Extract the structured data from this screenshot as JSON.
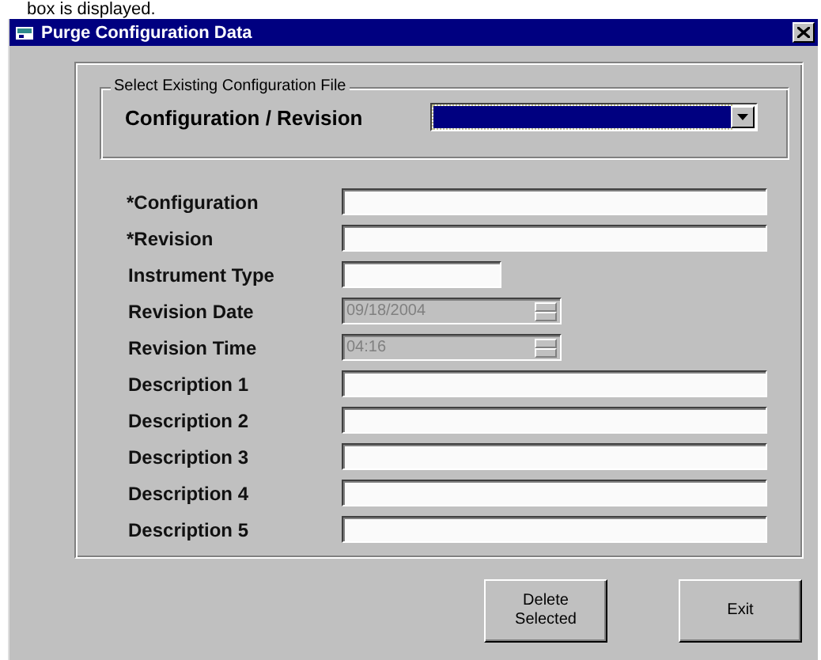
{
  "caption": "box is displayed.",
  "window": {
    "title": "Purge Configuration Data"
  },
  "group": {
    "title": "Select Existing Configuration File",
    "label": "Configuration / Revision",
    "dropdown": {
      "focused": true
    }
  },
  "fields": [
    {
      "label": "*Configuration",
      "kind": "wide",
      "disabled": false
    },
    {
      "label": "*Revision",
      "kind": "wide",
      "disabled": false
    },
    {
      "label": "Instrument Type",
      "kind": "narrow",
      "disabled": false
    },
    {
      "label": "Revision Date",
      "kind": "spin",
      "value": "09/18/2004",
      "disabled": true
    },
    {
      "label": "Revision Time",
      "kind": "spin",
      "value": "04:16",
      "disabled": true
    },
    {
      "label": "Description 1",
      "kind": "wide",
      "disabled": false
    },
    {
      "label": "Description 2",
      "kind": "wide",
      "disabled": false
    },
    {
      "label": "Description 3",
      "kind": "wide",
      "disabled": false
    },
    {
      "label": "Description 4",
      "kind": "wide",
      "disabled": false
    },
    {
      "label": "Description 5",
      "kind": "wide",
      "disabled": false
    }
  ],
  "buttons": [
    {
      "label": "Delete Selected"
    },
    {
      "label": "Exit"
    }
  ]
}
